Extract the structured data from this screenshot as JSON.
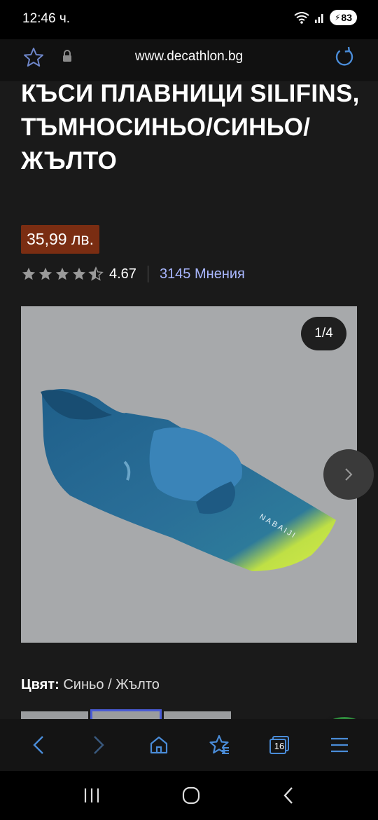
{
  "status_bar": {
    "time": "12:46 ч.",
    "battery": "83"
  },
  "browser": {
    "url": "www.decathlon.bg"
  },
  "product": {
    "title": "КЪСИ ПЛАВНИЦИ SILIFINS, ТЪМНОСИНЬО/СИНЬО/ЖЪЛТО",
    "price": "35,99 лв.",
    "rating": "4.67",
    "rating_stars": 4.67,
    "reviews": "3145 Мнения",
    "gallery_counter": "1/4",
    "fin_brand": "NABAIJI",
    "color_label": "Цвят:",
    "color_value": "Синьо / Жълто"
  },
  "toolbar": {
    "items": [
      "back-icon",
      "forward-icon",
      "home-icon",
      "bookmarks-icon",
      "tabs-icon",
      "menu-icon"
    ],
    "tabs_count": "16"
  },
  "colors": {
    "price_bg": "#7a2d12",
    "link": "#a9b7ff",
    "chat": "#2f8a3c",
    "swatch_selected": "#4a5cd6"
  }
}
